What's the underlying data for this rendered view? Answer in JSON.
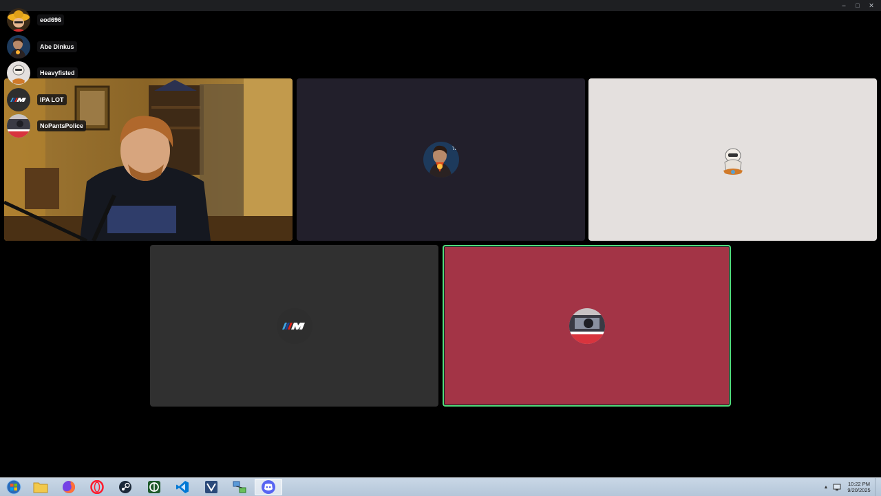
{
  "window": {
    "controls": {
      "minimize": "–",
      "maximize": "□",
      "close": "✕"
    }
  },
  "overlay": {
    "users": [
      {
        "name": "eod696",
        "avatar_icon": "sombrero-character-avatar-icon"
      },
      {
        "name": "Abe Dinkus",
        "avatar_icon": "lincoln-portrait-avatar-icon"
      },
      {
        "name": "Heavyfisted",
        "avatar_icon": "cartoon-gnome-avatar-icon"
      },
      {
        "name": "IPA LOT",
        "avatar_icon": "bmw-m-logo-avatar-icon"
      },
      {
        "name": "NoPantsPolice",
        "avatar_icon": "car-interior-avatar-icon"
      }
    ]
  },
  "tiles": [
    {
      "id": "webcam",
      "type": "video",
      "bg": "#8a6a2a"
    },
    {
      "id": "abe-dinkus",
      "type": "avatar",
      "bg": "#221f2b",
      "avatar_icon": "lincoln-portrait-avatar-icon"
    },
    {
      "id": "heavyfisted",
      "type": "avatar",
      "bg": "#e4e0de",
      "avatar_icon": "cartoon-gnome-avatar-icon"
    },
    {
      "id": "ipa-lot",
      "type": "avatar",
      "bg": "#303030",
      "avatar_icon": "bmw-m-logo-avatar-icon"
    },
    {
      "id": "nopantspolice",
      "type": "avatar",
      "bg": "#a33446",
      "avatar_icon": "car-interior-avatar-icon",
      "speaking": true,
      "speaking_color": "#4fdc7c"
    }
  ],
  "taskbar": {
    "apps": [
      {
        "name": "start-button",
        "icon": "windows-orb-icon"
      },
      {
        "name": "file-explorer",
        "icon": "folder-icon"
      },
      {
        "name": "firefox",
        "icon": "firefox-icon"
      },
      {
        "name": "opera",
        "icon": "opera-icon"
      },
      {
        "name": "steam",
        "icon": "steam-icon"
      },
      {
        "name": "unknown-app",
        "icon": "green-app-icon"
      },
      {
        "name": "vscode",
        "icon": "vscode-icon"
      },
      {
        "name": "visual-studio",
        "icon": "visual-studio-icon"
      },
      {
        "name": "network-app",
        "icon": "network-icon"
      },
      {
        "name": "discord",
        "icon": "discord-icon",
        "active": true
      }
    ],
    "clock": {
      "time": "10:22 PM",
      "date": "9/20/2025"
    }
  }
}
